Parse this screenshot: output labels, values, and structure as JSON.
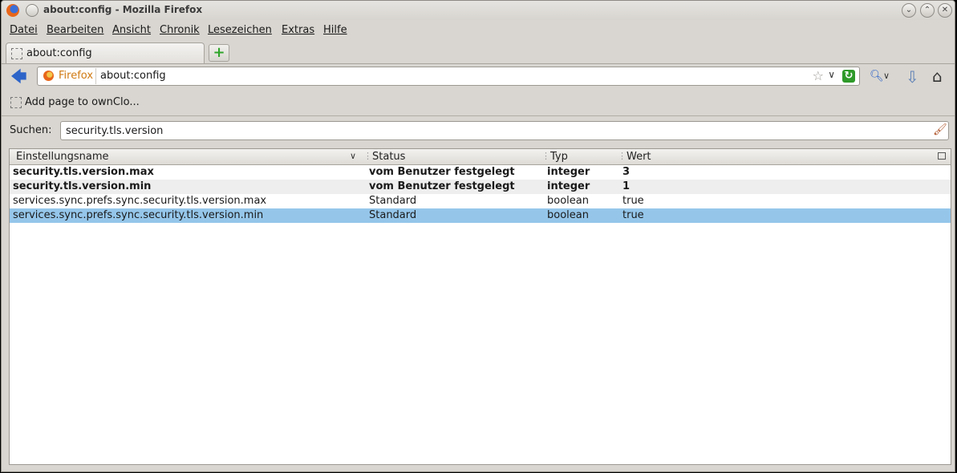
{
  "window": {
    "title": "about:config - Mozilla Firefox",
    "controls": {
      "minimize": "⌄",
      "maximize": "⌃",
      "close": "✕"
    }
  },
  "menubar": {
    "items": [
      {
        "label": "Datei"
      },
      {
        "label": "Bearbeiten"
      },
      {
        "label": "Ansicht"
      },
      {
        "label": "Chronik"
      },
      {
        "label": "Lesezeichen"
      },
      {
        "label": "Extras"
      },
      {
        "label": "Hilfe"
      }
    ]
  },
  "tabs": [
    {
      "label": "about:config",
      "icon": "blank-page-icon"
    }
  ],
  "new_tab": {
    "label": "+"
  },
  "navbar": {
    "identity_label": "Firefox",
    "url": "about:config",
    "icons": [
      "back-arrow-icon",
      "firefox-identity-icon",
      "star-icon",
      "dropdown-icon",
      "reload-icon",
      "search-engine-icon",
      "download-icon",
      "home-icon"
    ]
  },
  "bookmarks": {
    "items": [
      {
        "label": "Add page to ownClo..."
      }
    ]
  },
  "config": {
    "search_label": "Suchen:",
    "search_value": "security.tls.version",
    "columns": [
      "Einstellungsname",
      "Status",
      "Typ",
      "Wert"
    ],
    "rows": [
      {
        "name": "security.tls.version.max",
        "status": "vom Benutzer festgelegt",
        "type": "integer",
        "value": "3",
        "modified": true
      },
      {
        "name": "security.tls.version.min",
        "status": "vom Benutzer festgelegt",
        "type": "integer",
        "value": "1",
        "modified": true
      },
      {
        "name": "services.sync.prefs.sync.security.tls.version.max",
        "status": "Standard",
        "type": "boolean",
        "value": "true",
        "modified": false
      },
      {
        "name": "services.sync.prefs.sync.security.tls.version.min",
        "status": "Standard",
        "type": "boolean",
        "value": "true",
        "modified": false,
        "selected": true
      }
    ]
  },
  "colors": {
    "selection": "#95c6ea",
    "window_bg": "#d9d6d1",
    "identity": "#d07a12",
    "accent_green": "#2f9a2a"
  }
}
